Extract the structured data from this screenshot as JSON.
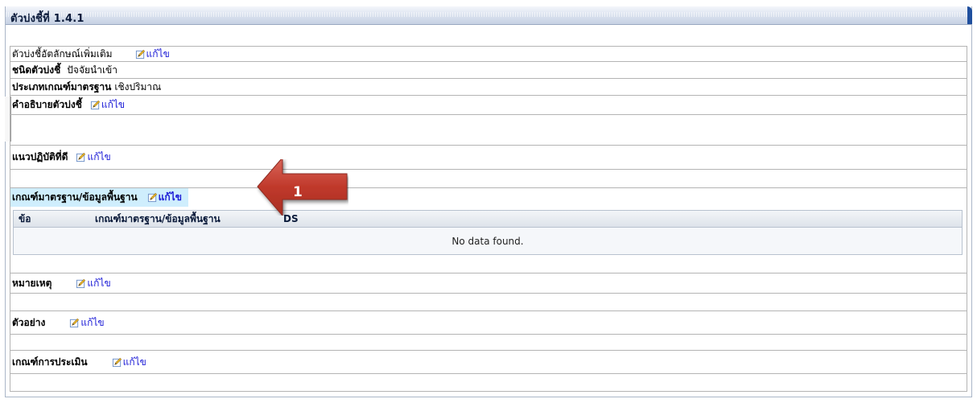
{
  "panel": {
    "title": "ตัวบ่งชี้ที่ 1.4.1"
  },
  "edit_label": "แก้ไข",
  "rows": {
    "identity": {
      "label": "ตัวบ่งชี้อัตลักษณ์เพิ่มเติม"
    },
    "indicator_type": {
      "label": "ชนิดตัวบ่งชี้",
      "value": "ปัจจัยนำเข้า"
    },
    "criteria_type": {
      "label": "ประเภทเกณฑ์มาตรฐาน",
      "value": "เชิงปริมาณ"
    },
    "description": {
      "label": "คำอธิบายตัวบ่งชี้"
    },
    "best_practice": {
      "label": "แนวปฏิบัติที่ดี"
    },
    "baseline": {
      "label": "เกณฑ์มาตรฐาน/ข้อมูลพื้นฐาน"
    },
    "note": {
      "label": "หมายเหตุ"
    },
    "example": {
      "label": "ตัวอย่าง"
    },
    "evaluation": {
      "label": "เกณฑ์การประเมิน"
    }
  },
  "baseline_table": {
    "columns": [
      "ข้อ",
      "เกณฑ์มาตรฐาน/ข้อมูลพื้นฐาน",
      "DS"
    ],
    "empty_message": "No data found."
  },
  "callout": {
    "number": "1",
    "color": "#c0392b"
  },
  "colors": {
    "link": "#1a1ad6",
    "highlight": "#cfeefd",
    "header_accent": "#1f4f9e"
  }
}
